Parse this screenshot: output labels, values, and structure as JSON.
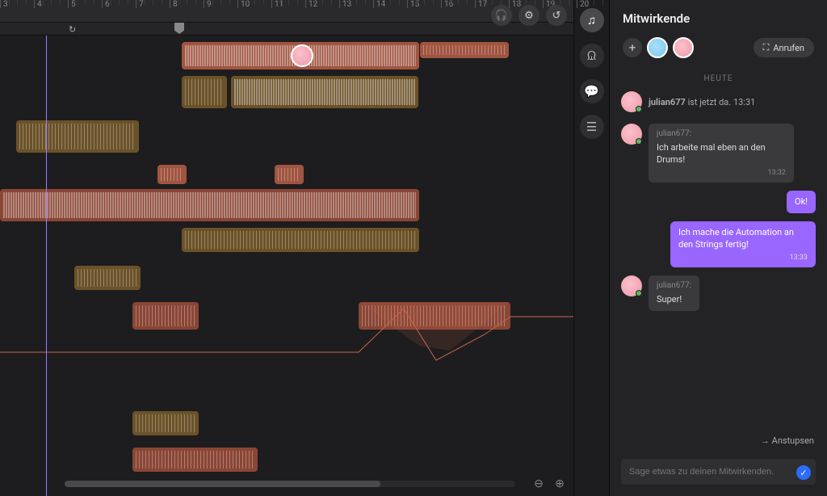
{
  "ruler": {
    "start": 3,
    "end": 20
  },
  "sidebar": {
    "title": "Mitwirkende",
    "call_label": "Anrufen",
    "nudge_label": "Anstupsen",
    "compose_placeholder": "Sage etwas zu deinen Mitwirkenden.",
    "day_label": "HEUTE"
  },
  "presence": {
    "user": "julian677",
    "text": "ist jetzt da.",
    "time": "13:31"
  },
  "messages": [
    {
      "author": "julian677:",
      "text": "Ich arbeite mal eben an den Drums!",
      "time": "13:32",
      "mine": false
    },
    {
      "text": "Ok!",
      "mine": true
    },
    {
      "text": "Ich mache die Automation an den Strings fertig!",
      "time": "13:33",
      "mine": true
    },
    {
      "author": "julian677:",
      "text": "Super!",
      "mine": false
    }
  ],
  "icons": {
    "loop": "↻",
    "settings": "⚙",
    "undo": "↺",
    "headphones": "🎧",
    "music": "♫",
    "people": "ᙉ",
    "chat": "💬",
    "sliders": "☰",
    "add": "+",
    "video": "⛶",
    "arrow": "→",
    "check": "✓",
    "zoom_out": "⊖",
    "zoom_in": "⊕"
  }
}
